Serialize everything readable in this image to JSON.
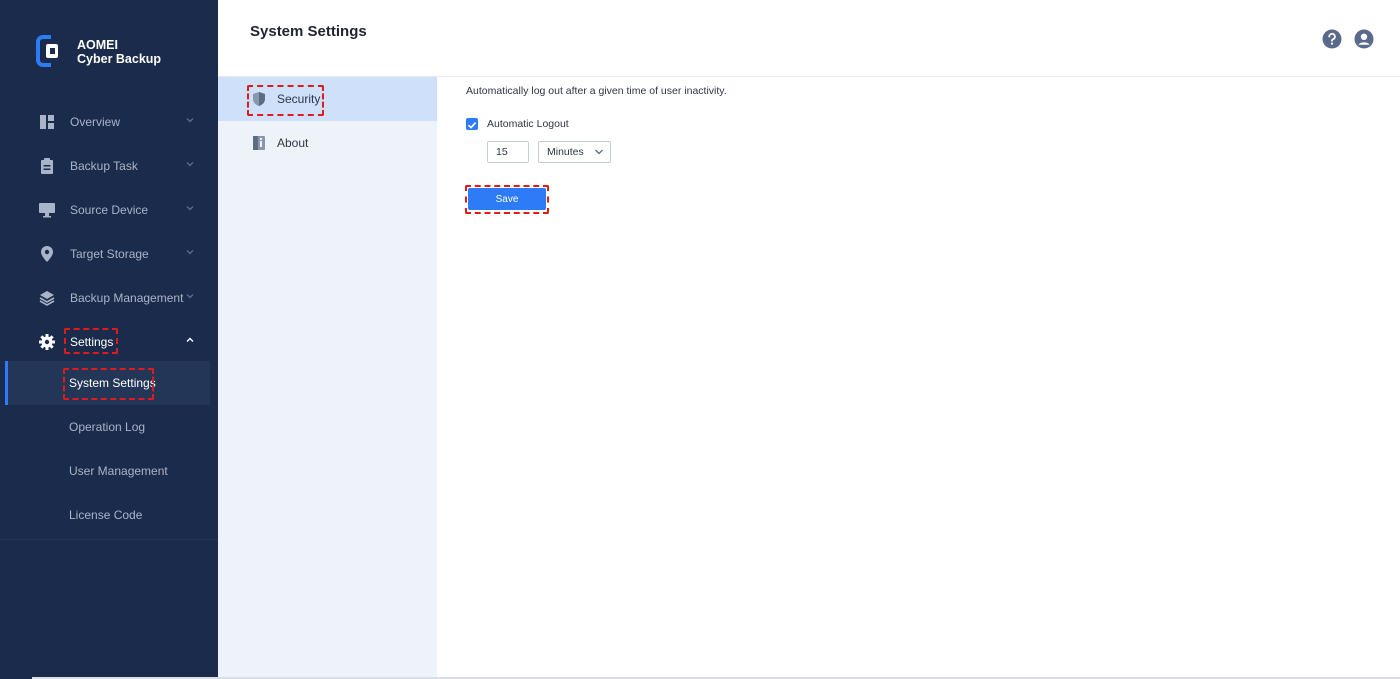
{
  "brand": {
    "line1": "AOMEI",
    "line2": "Cyber Backup"
  },
  "sidebar": {
    "items": [
      {
        "label": "Overview",
        "icon": "dashboard-icon"
      },
      {
        "label": "Backup Task",
        "icon": "clipboard-icon"
      },
      {
        "label": "Source Device",
        "icon": "monitor-icon"
      },
      {
        "label": "Target Storage",
        "icon": "location-pin-icon"
      },
      {
        "label": "Backup Management",
        "icon": "layers-icon"
      },
      {
        "label": "Settings",
        "icon": "gear-icon",
        "expanded": true
      }
    ],
    "settings_sub": [
      {
        "label": "System Settings",
        "active": true
      },
      {
        "label": "Operation Log"
      },
      {
        "label": "User Management"
      },
      {
        "label": "License Code"
      }
    ]
  },
  "header": {
    "title": "System Settings",
    "icons": [
      "help-icon",
      "user-icon"
    ]
  },
  "subnav": [
    {
      "label": "Security",
      "icon": "shield-icon",
      "active": true
    },
    {
      "label": "About",
      "icon": "info-book-icon"
    }
  ],
  "security": {
    "description": "Automatically log out after a given time of user inactivity.",
    "auto_logout_label": "Automatic Logout",
    "auto_logout_checked": true,
    "timeout_value": "15",
    "unit": "Minutes",
    "save_label": "Save"
  },
  "colors": {
    "sidebar_bg": "#1b2b4b",
    "accent": "#2d7bf6",
    "highlight": "#e01b1b",
    "subnav_bg": "#eef2f9"
  }
}
